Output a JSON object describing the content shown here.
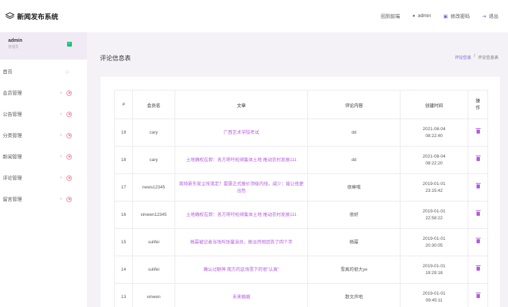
{
  "app": {
    "title": "新闻发布系统"
  },
  "topnav": {
    "home": "回到前端",
    "user": "admin",
    "change_pw": "修改密码",
    "logout": "退出"
  },
  "sidebar": {
    "user_name": "admin",
    "user_role": "管理员",
    "items": [
      {
        "label": "首页"
      },
      {
        "label": "会员管理"
      },
      {
        "label": "公告管理"
      },
      {
        "label": "分类管理"
      },
      {
        "label": "新闻管理"
      },
      {
        "label": "评论管理"
      },
      {
        "label": "留言管理"
      }
    ]
  },
  "page": {
    "title": "评论信息表",
    "breadcrumb": {
      "parent": "评论信息",
      "sep": "/",
      "current": "评论信息表"
    }
  },
  "table": {
    "headers": [
      "#",
      "会员名",
      "文章",
      "评论内容",
      "创建时间",
      "操作"
    ],
    "rows": [
      {
        "id": "19",
        "user": "cary",
        "article": "广西艺术学院考试",
        "content": "dd",
        "date": "2021-08-04",
        "time": "08:22:40"
      },
      {
        "id": "18",
        "user": "cary",
        "article": "土地确权在即：各方呼吁松绑集体土地 推动农村发展111",
        "content": "dd",
        "date": "2021-08-04",
        "time": "08:22:20"
      },
      {
        "id": "17",
        "user": "news12345",
        "article": "周琦新东家尘埃落定？雷霆正式报价顶级内线，威少：能让他更出色",
        "content": "很棒哦",
        "date": "2019-01-01",
        "time": "23:15:42"
      },
      {
        "id": "16",
        "user": "xinwen12345",
        "article": "土地确权在即：各方呼吁松绑集体土地 推动农村发展111",
        "content": "很好",
        "date": "2019-01-01",
        "time": "22:58:22"
      },
      {
        "id": "15",
        "user": "sulifei",
        "article": "杨幂被记者当场叫张量演员，她淡然地回答了四个字",
        "content": "杨幂",
        "date": "2019-01-01",
        "time": "20:30:05"
      },
      {
        "id": "14",
        "user": "sulifei",
        "article": "确认过眼神 南方的这场雪下的很\"认真\"",
        "content": "雪真的很大ye",
        "date": "2019-01-01",
        "time": "19:29:18"
      },
      {
        "id": "13",
        "user": "xinwen",
        "article": "未来婚姻",
        "content": "散文声地",
        "date": "2019-01-01",
        "time": "09:45:11"
      }
    ]
  },
  "colors": {
    "accent": "#7b61d8",
    "link": "#b45ddf",
    "bg": "#f5f2f7"
  }
}
